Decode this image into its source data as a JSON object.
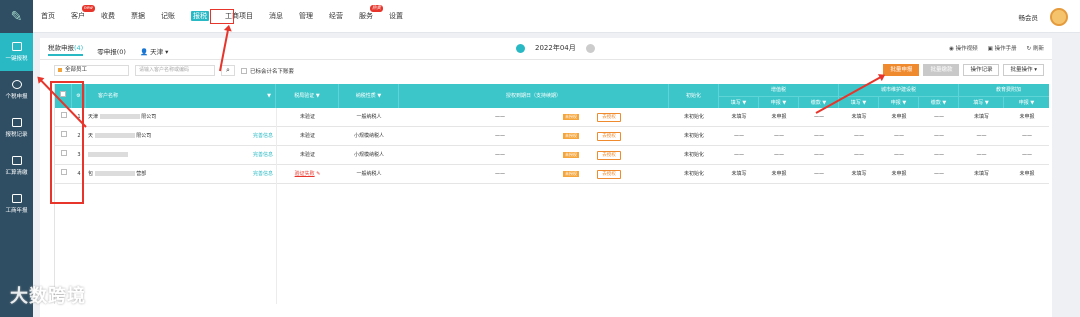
{
  "sidebar": {
    "items": [
      {
        "label": "一键报税",
        "active": true
      },
      {
        "label": "个税申报",
        "active": false
      },
      {
        "label": "报税记录",
        "active": false
      },
      {
        "label": "汇算清缴",
        "active": false
      },
      {
        "label": "工商年报",
        "active": false
      }
    ]
  },
  "topnav": {
    "items": [
      {
        "label": "首页"
      },
      {
        "label": "客户",
        "badge": "new"
      },
      {
        "label": "收费"
      },
      {
        "label": "票据"
      },
      {
        "label": "记账"
      },
      {
        "label": "报税",
        "active": true
      },
      {
        "label": "工商项目"
      },
      {
        "label": "消息"
      },
      {
        "label": "管理"
      },
      {
        "label": "经营"
      },
      {
        "label": "服务",
        "badge": "热卖"
      },
      {
        "label": "设置"
      }
    ],
    "user": "畅会员"
  },
  "tabs": [
    {
      "label": "税款申报",
      "count": "(4)"
    },
    {
      "label": "零申报(0)"
    },
    {
      "label": "天津"
    }
  ],
  "period": "2022年04月",
  "top_ops": [
    "操作视频",
    "操作手册",
    "刷新"
  ],
  "filter": {
    "employee_select": "全部员工",
    "search_placeholder": "请输入客户名称或编码",
    "checkbox_label": "已标会计名下账套"
  },
  "buttons": [
    "批量申报",
    "批量缴款",
    "操作记录",
    "批量操作"
  ],
  "table": {
    "headers": {
      "customer": "客户名称",
      "cert": "税局验证",
      "taxpayer": "纳税性质",
      "auth": "授权到期日（支持续期）",
      "init": "初始化",
      "vat": "增值税",
      "city": "城市维护建设税",
      "edu": "教育费附加",
      "fill": "填写",
      "declare": "申报",
      "pay": "缴款"
    },
    "rows": [
      {
        "idx": "1",
        "name_start": "天津",
        "name_end": "限公司",
        "info": "",
        "cert": "未验证",
        "cert_red": false,
        "type": "一般纳税人",
        "auth": "——",
        "renew": "未授权",
        "renew_btn": "去授权",
        "init": "未初始化",
        "vat": [
          "未填写",
          "未申报",
          "——"
        ],
        "city": [
          "未填写",
          "未申报",
          "——"
        ],
        "edu": [
          "未填写",
          "未申报"
        ]
      },
      {
        "idx": "2",
        "name_start": "天",
        "name_end": "限公司",
        "info": "完善信息",
        "cert": "未验证",
        "cert_red": false,
        "type": "小规模纳税人",
        "auth": "——",
        "renew": "未授权",
        "renew_btn": "去授权",
        "init": "未初始化",
        "vat": [
          "——",
          "——",
          "——"
        ],
        "city": [
          "——",
          "——",
          "——"
        ],
        "edu": [
          "——",
          "——"
        ]
      },
      {
        "idx": "3",
        "name_start": "",
        "name_end": "",
        "info": "完善信息",
        "cert": "未验证",
        "cert_red": false,
        "type": "小规模纳税人",
        "auth": "——",
        "renew": "未授权",
        "renew_btn": "去授权",
        "init": "未初始化",
        "vat": [
          "——",
          "——",
          "——"
        ],
        "city": [
          "——",
          "——",
          "——"
        ],
        "edu": [
          "——",
          "——"
        ]
      },
      {
        "idx": "4",
        "name_start": "包",
        "name_end": "营部",
        "info": "完善信息",
        "cert": "验证失败",
        "cert_red": true,
        "type": "一般纳税人",
        "auth": "——",
        "renew": "未授权",
        "renew_btn": "去授权",
        "init": "未初始化",
        "vat": [
          "未填写",
          "未申报",
          "——"
        ],
        "city": [
          "未填写",
          "未申报",
          "——"
        ],
        "edu": [
          "未填写",
          "未申报"
        ]
      }
    ]
  },
  "watermark": "大数跨境",
  "colors": {
    "accent": "#29b9c5",
    "header": "#3cc6c9",
    "sidebar": "#2f4e63",
    "orange": "#f08a2e",
    "red": "#e7352b"
  }
}
